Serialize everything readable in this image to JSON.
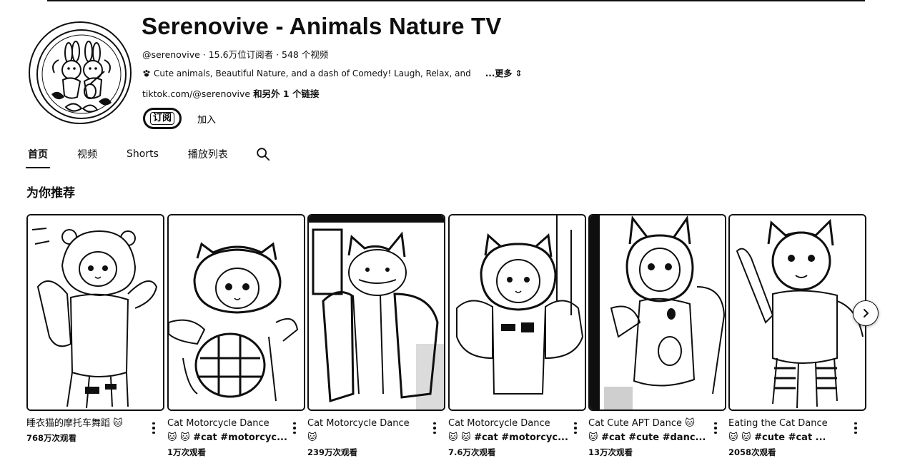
{
  "channel": {
    "title": "Serenovive - Animals Nature TV",
    "handle": "@serenovive",
    "subscribers": "15.6万位订阅者",
    "video_count": "548 个视频",
    "description": "Cute animals, Beautiful Nature, and a dash of Comedy!  Laugh, Relax, and",
    "description_icons": [
      "paw-icon",
      "mountain-icon",
      "sparkle-icon",
      "smile-icon"
    ],
    "more_label": "...更多",
    "link": "tiktok.com/@serenovive",
    "link_extra": "和另外 1 个链接",
    "subscribe_label": "订阅",
    "join_label": "加入"
  },
  "tabs": [
    {
      "label": "首页",
      "active": true
    },
    {
      "label": "视频",
      "active": false
    },
    {
      "label": "Shorts",
      "active": false
    },
    {
      "label": "播放列表",
      "active": false
    }
  ],
  "section": {
    "title": "为你推荐"
  },
  "videos": [
    {
      "title_line1": "睡衣猫的摩托车舞蹈 🐱",
      "title_line2": "",
      "views": "768万次观看"
    },
    {
      "title_line1": "Cat Motorcycle Dance",
      "title_line2": "🐱 🐱 #cat #motorcyc...",
      "views": "1万次观看"
    },
    {
      "title_line1": "Cat Motorcycle Dance",
      "title_line2": "🐱",
      "views": "239万次观看"
    },
    {
      "title_line1": "Cat Motorcycle Dance",
      "title_line2": "🐱 🐱 #cat #motorcyc...",
      "views": "7.6万次观看"
    },
    {
      "title_line1": "Cat Cute APT Dance 🐱",
      "title_line2": "🐱  #cat #cute #danc...",
      "views": "13万次观看"
    },
    {
      "title_line1": "Eating the Cat Dance",
      "title_line2": "🐱 🐱 #cute #cat ...",
      "views": "2058次观看"
    }
  ],
  "icons": {
    "search": "search-icon",
    "more": "more-vert-icon",
    "next": "chevron-right-icon"
  },
  "colors": {
    "text": "#0f0f0f",
    "background": "#ffffff"
  }
}
